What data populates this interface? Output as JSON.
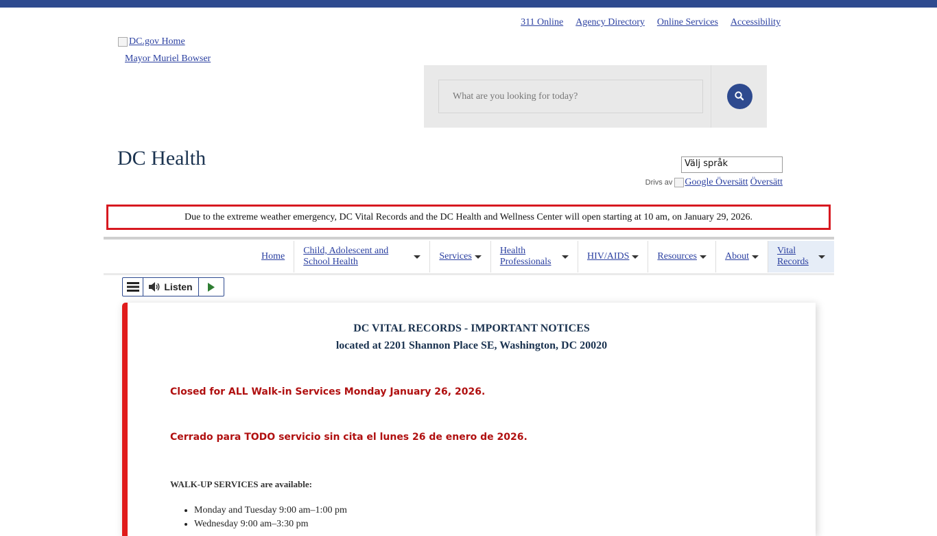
{
  "utility_nav": [
    "311 Online",
    "Agency Directory",
    "Online Services",
    "Accessibility"
  ],
  "logo": {
    "alt": "DC.gov Home",
    "mayor_link": "Mayor Muriel Bowser"
  },
  "search": {
    "placeholder": "What are you looking for today?"
  },
  "site_title": "DC Health",
  "translate": {
    "select_label": "Välj språk",
    "powered_by": "Drivs av",
    "google_img_alt": "Google Översätt",
    "link": "Översätt"
  },
  "alert": "Due to the extreme weather emergency, DC Vital Records and the DC Health and Wellness Center will open starting at 10 am, on January 29, 2026.",
  "nav": {
    "items": [
      {
        "label": "Home",
        "dropdown": false
      },
      {
        "label": "Child, Adolescent and School Health",
        "dropdown": true
      },
      {
        "label": "Services",
        "dropdown": true
      },
      {
        "label": "Health Professionals",
        "dropdown": true
      },
      {
        "label": "HIV/AIDS",
        "dropdown": true
      },
      {
        "label": "Resources",
        "dropdown": true
      },
      {
        "label": "About",
        "dropdown": true
      },
      {
        "label": "Vital Records",
        "dropdown": true,
        "active": true
      }
    ]
  },
  "listen": {
    "label": "Listen"
  },
  "content": {
    "title_line1": "DC VITAL RECORDS - IMPORTANT NOTICES",
    "title_line2": "located at 2201 Shannon Place SE, Washington, DC 20020",
    "notice_en": "Closed for ALL Walk-in Services Monday January 26, 2026.",
    "notice_es": "Cerrado para TODO servicio sin cita el lunes 26 de enero de 2026.",
    "walkup_heading": "WALK-UP SERVICES are available:",
    "hours": [
      "Monday and Tuesday 9:00 am–1:00 pm",
      "Wednesday 9:00 am–3:30 pm"
    ]
  },
  "colors": {
    "brand_blue": "#2e4a8f",
    "alert_red": "#d71920",
    "notice_red": "#b01010"
  }
}
